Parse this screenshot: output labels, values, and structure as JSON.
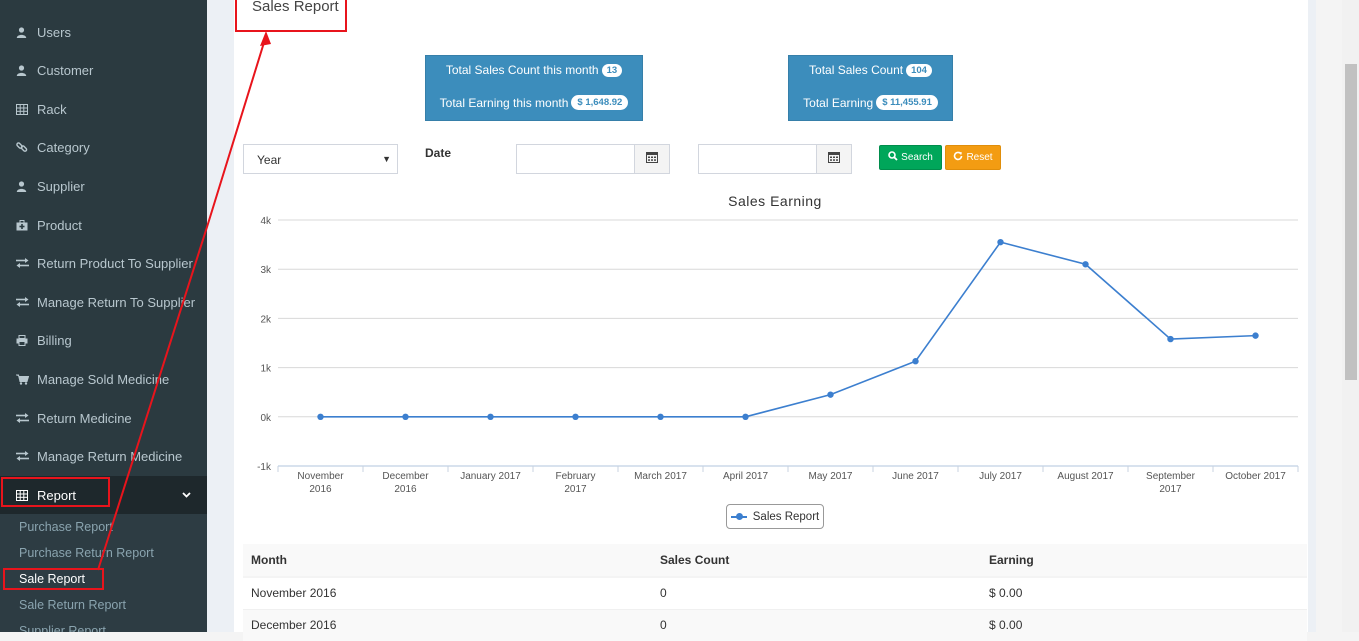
{
  "sidebar": {
    "items": [
      {
        "label": "Users",
        "icon": "user-icon"
      },
      {
        "label": "Customer",
        "icon": "user-icon"
      },
      {
        "label": "Rack",
        "icon": "table-icon"
      },
      {
        "label": "Category",
        "icon": "link-icon"
      },
      {
        "label": "Supplier",
        "icon": "user-icon"
      },
      {
        "label": "Product",
        "icon": "medkit-icon"
      },
      {
        "label": "Return Product To Supplier",
        "icon": "exchange-icon"
      },
      {
        "label": "Manage Return To Supplier",
        "icon": "exchange-icon"
      },
      {
        "label": "Billing",
        "icon": "print-icon"
      },
      {
        "label": "Manage Sold Medicine",
        "icon": "cart-icon"
      },
      {
        "label": "Return Medicine",
        "icon": "exchange-icon"
      },
      {
        "label": "Manage Return Medicine",
        "icon": "exchange-icon"
      }
    ],
    "report": {
      "label": "Report",
      "icon": "table-icon"
    },
    "report_sub": [
      "Purchase Report",
      "Purchase Return Report",
      "Sale Report",
      "Sale Return Report",
      "Supplier Report"
    ]
  },
  "page": {
    "title": "Sales Report"
  },
  "stats": {
    "month_count_label": "Total Sales Count this month",
    "month_count": "13",
    "month_earning_label": "Total Earning this month",
    "month_earning": "$ 1,648.92",
    "total_count_label": "Total Sales Count",
    "total_count": "104",
    "total_earning_label": "Total Earning",
    "total_earning": "$ 11,455.91"
  },
  "filters": {
    "period_selected": "Year",
    "date_label": "Date",
    "search_label": "Search",
    "reset_label": "Reset"
  },
  "chart_data": {
    "type": "line",
    "title": "Sales Earning",
    "categories": [
      [
        "November",
        "2016"
      ],
      [
        "December",
        "2016"
      ],
      [
        "January 2017"
      ],
      [
        "February",
        "2017"
      ],
      [
        "March 2017"
      ],
      [
        "April 2017"
      ],
      [
        "May 2017"
      ],
      [
        "June 2017"
      ],
      [
        "July 2017"
      ],
      [
        "August 2017"
      ],
      [
        "September",
        "2017"
      ],
      [
        "October 2017"
      ]
    ],
    "series": [
      {
        "name": "Sales Report",
        "values": [
          0,
          0,
          0,
          0,
          0,
          0,
          450,
          1130,
          3550,
          3100,
          1580,
          1650
        ]
      }
    ],
    "ylim": [
      -1000,
      4000
    ],
    "yticks": [
      "-1k",
      "0k",
      "1k",
      "2k",
      "3k",
      "4k"
    ],
    "ytick_values": [
      -1000,
      0,
      1000,
      2000,
      3000,
      4000
    ],
    "grid": true,
    "legend": "bottom",
    "color": "#3c7fcf"
  },
  "table": {
    "headers": [
      "Month",
      "Sales Count",
      "Earning"
    ],
    "rows": [
      [
        "November 2016",
        "0",
        "$ 0.00"
      ],
      [
        "December 2016",
        "0",
        "$ 0.00"
      ]
    ]
  }
}
